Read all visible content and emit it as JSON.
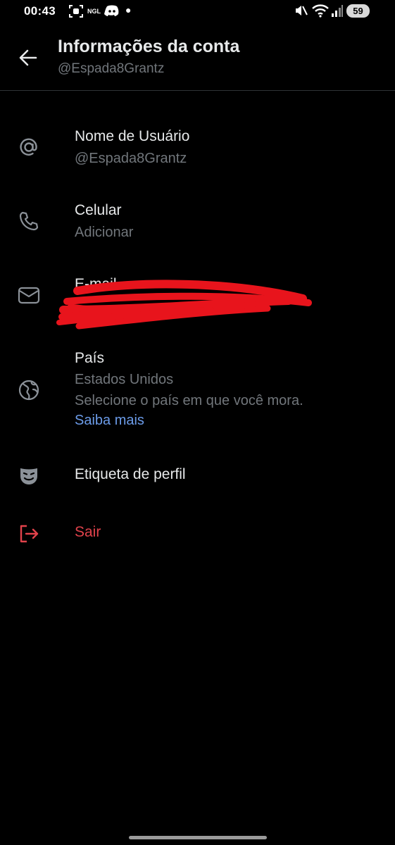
{
  "status_bar": {
    "time": "00:43",
    "ngl_label": "NGL",
    "battery": "59"
  },
  "header": {
    "title": "Informações da conta",
    "subtitle": "@Espada8Grantz"
  },
  "items": [
    {
      "icon": "at-icon",
      "label": "Nome de Usuário",
      "value": "@Espada8Grantz"
    },
    {
      "icon": "phone-icon",
      "label": "Celular",
      "value": "Adicionar"
    },
    {
      "icon": "mail-icon",
      "label": "E-mail",
      "value": ""
    },
    {
      "icon": "globe-icon",
      "label": "País",
      "value": "Estados Unidos",
      "description": "Selecione o país em que você mora.",
      "link": "Saiba mais"
    },
    {
      "icon": "mask-icon",
      "label": "Etiqueta de perfil"
    },
    {
      "icon": "logout-icon",
      "label": "Sair"
    }
  ],
  "colors": {
    "background": "#000000",
    "primary_text": "#e7e9ea",
    "secondary_text": "#71767b",
    "link": "#6b9be8",
    "danger": "#e0424b",
    "redaction": "#e8141c"
  }
}
